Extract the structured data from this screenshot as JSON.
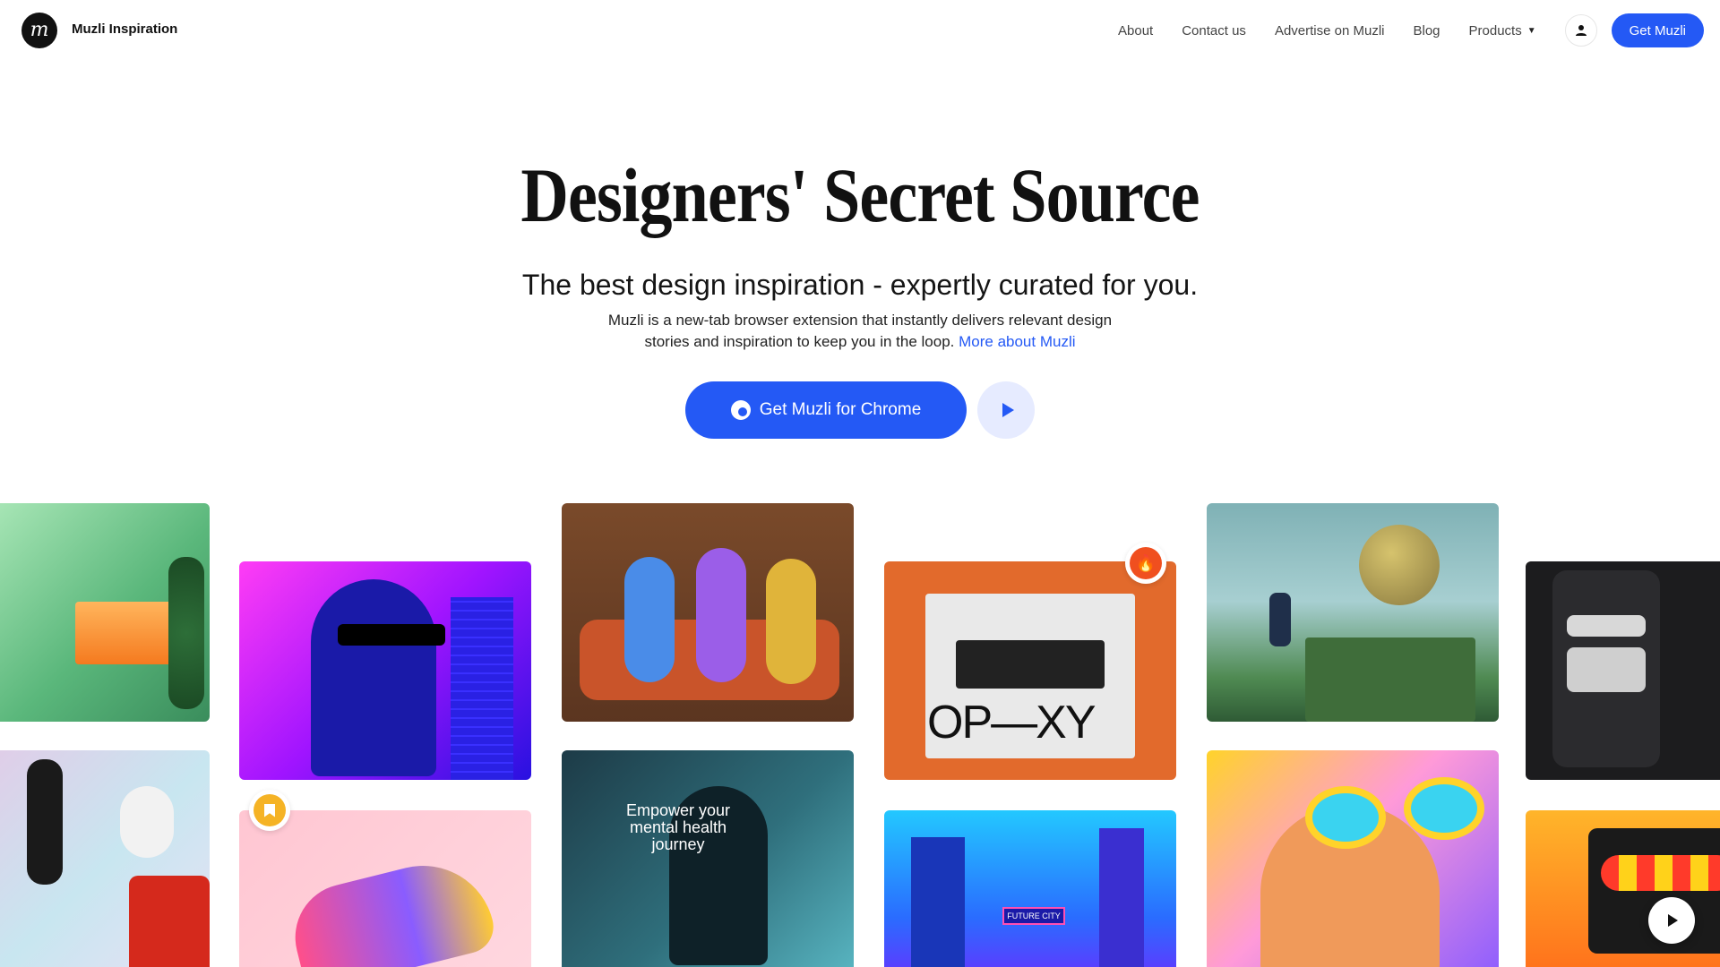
{
  "header": {
    "logo_glyph": "m",
    "brand": "Muzli Inspiration",
    "nav": {
      "about": "About",
      "contact": "Contact us",
      "advertise": "Advertise on Muzli",
      "blog": "Blog",
      "products": "Products"
    },
    "cta": "Get Muzli"
  },
  "hero": {
    "title": "Designers' Secret Source",
    "subtitle": "The best design inspiration - expertly curated for you.",
    "description": "Muzli is a new-tab browser extension that instantly delivers relevant design stories and inspiration to keep you in the loop.",
    "more_link": "More about Muzli",
    "cta": "Get Muzli for Chrome"
  },
  "gallery": {
    "card_opxy_text": "OP—XY",
    "card_health_text": "Empower your mental health journey",
    "card_city_sign": "FUTURE CITY"
  },
  "icons": {
    "user": "user-icon",
    "chrome": "chrome-icon",
    "play": "play-icon",
    "fire": "fire-icon",
    "bookmark": "bookmark-icon",
    "caret": "chevron-down-icon"
  },
  "colors": {
    "accent": "#2459f5",
    "accent_light": "#e6ebff",
    "fire_badge": "#f04f1f",
    "save_badge": "#f5b325"
  }
}
